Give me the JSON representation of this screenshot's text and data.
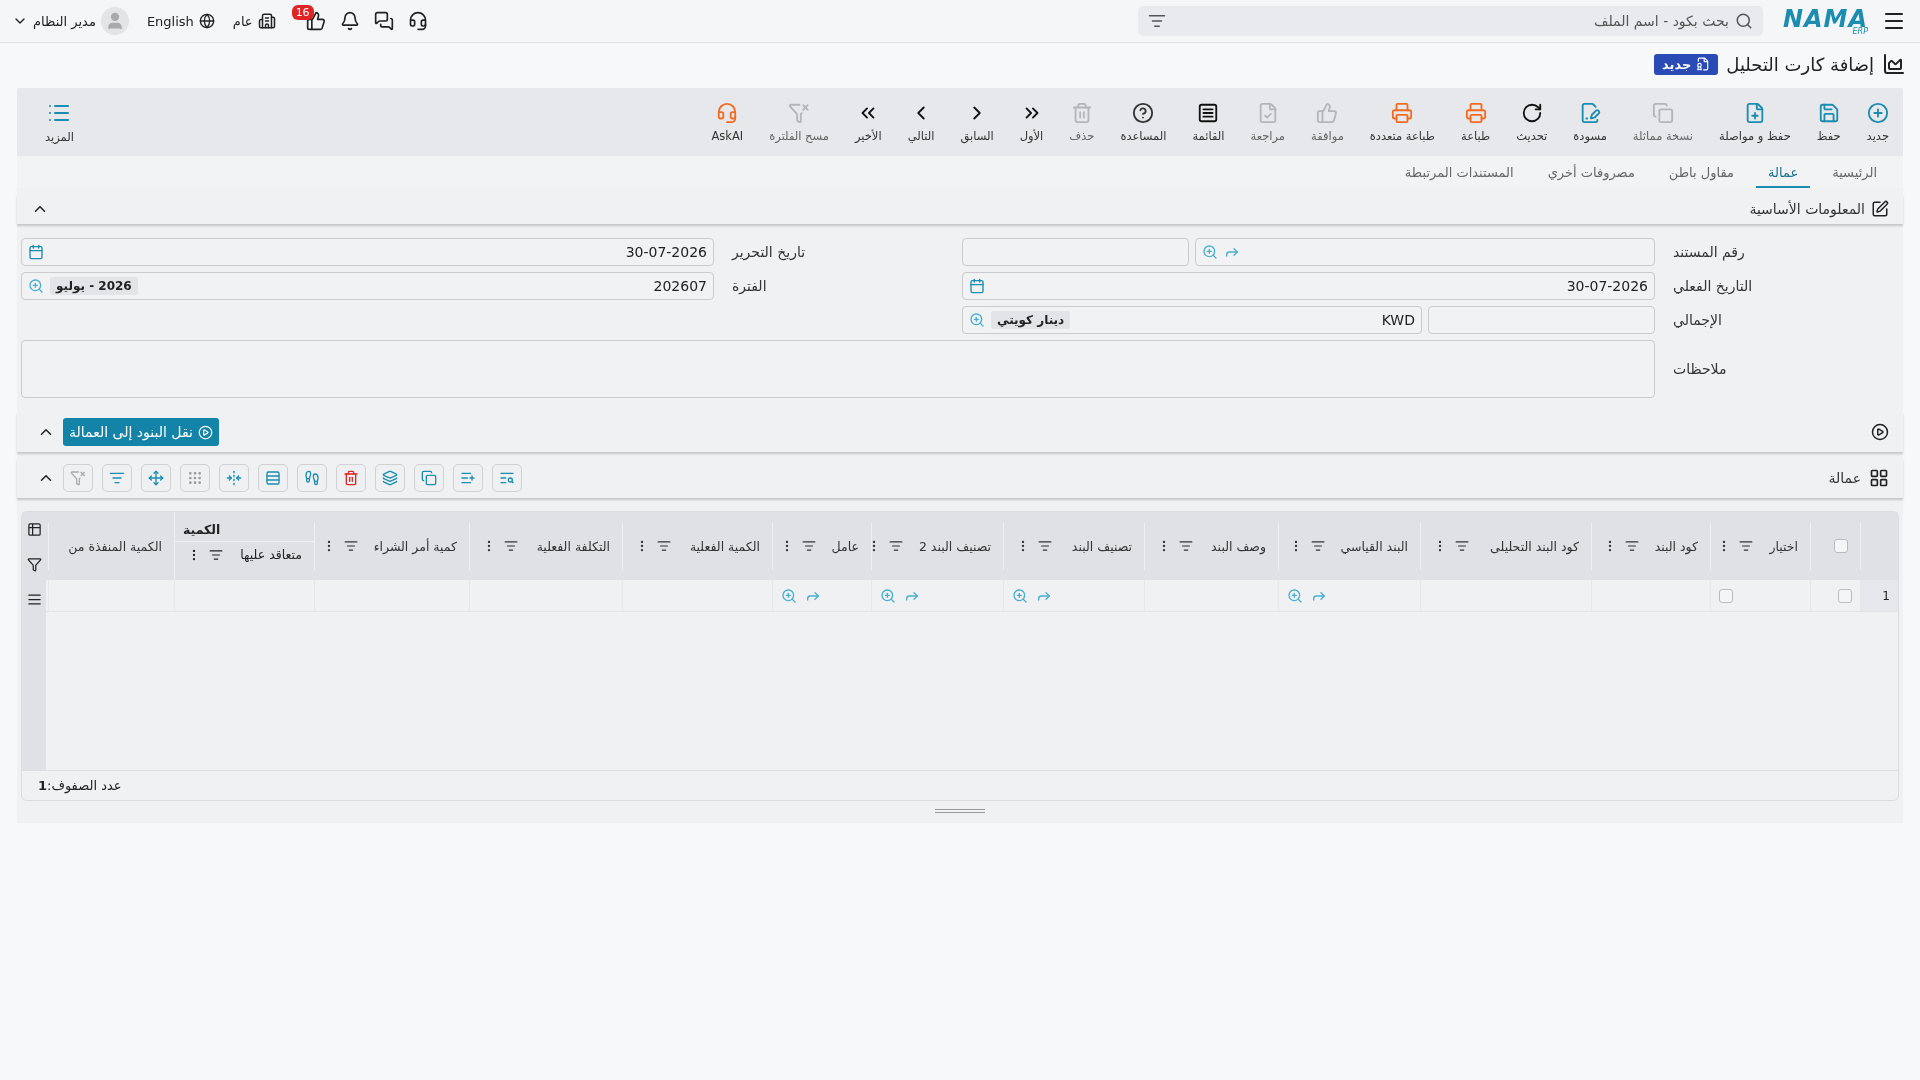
{
  "top_bar": {
    "logo": "NAMA",
    "logo_sub": "ERP",
    "search": {
      "placeholder": "بحث بكود - اسم الملف"
    },
    "user": "مدير النظام",
    "language": "English",
    "branch": "عام",
    "notification_count": "16"
  },
  "page": {
    "title": "إضافة كارت التحليل",
    "badge": "جديد"
  },
  "toolbar": [
    {
      "label": "جديد",
      "disabled": false
    },
    {
      "label": "حفظ",
      "disabled": false
    },
    {
      "label": "حفظ و مواصلة",
      "disabled": false
    },
    {
      "label": "نسخة مماثلة",
      "disabled": true
    },
    {
      "label": "مسودة",
      "disabled": false
    },
    {
      "label": "تحديث",
      "disabled": false
    },
    {
      "label": "طباعة",
      "disabled": false
    },
    {
      "label": "طباعة متعددة",
      "disabled": false
    },
    {
      "label": "موافقة",
      "disabled": true
    },
    {
      "label": "مراجعة",
      "disabled": true
    },
    {
      "label": "القائمة",
      "disabled": false
    },
    {
      "label": "المساعدة",
      "disabled": false
    },
    {
      "label": "حذف",
      "disabled": true
    },
    {
      "label": "الأول",
      "disabled": false
    },
    {
      "label": "السابق",
      "disabled": false
    },
    {
      "label": "التالي",
      "disabled": false
    },
    {
      "label": "الأخير",
      "disabled": false
    },
    {
      "label": "مسح الفلترة",
      "disabled": true
    },
    {
      "label": "AskAI",
      "disabled": false
    }
  ],
  "more": "المزيد",
  "tabs": [
    {
      "label": "الرئيسية",
      "selected": false
    },
    {
      "label": "عمالة",
      "selected": true
    },
    {
      "label": "مقاول باطن",
      "selected": false
    },
    {
      "label": "مصروفات أخري",
      "selected": false
    },
    {
      "label": "المستندات المرتبطة",
      "selected": false
    }
  ],
  "basic_info": {
    "title": "المعلومات الأساسية",
    "document_number": {
      "label": "رقم المستند"
    },
    "actual_date": {
      "label": "التاريخ الفعلي",
      "value": "30-07-2026"
    },
    "total": {
      "label": "الإجمالي",
      "currency": "KWD",
      "currency_name": "دينار كويتي"
    },
    "notes": {
      "label": "ملاحظات"
    },
    "edit_date": {
      "label": "تاريخ التحرير",
      "value": "30-07-2026"
    },
    "period": {
      "label": "الفترة",
      "value": "202607",
      "period_name": "2026 - يوليو"
    }
  },
  "action": {
    "label": "نقل البنود إلى العمالة"
  },
  "grid": {
    "title": "عمالة",
    "select_all": {
      "checked": false
    },
    "columns": [
      {
        "label": "اختيار",
        "kind": "check",
        "filter": true
      },
      {
        "label": "كود البند",
        "kind": "text",
        "filter": true
      },
      {
        "label": "كود البند التحليلى",
        "kind": "text",
        "filter": true
      },
      {
        "label": "البند القياسي",
        "kind": "lookup",
        "filter": true
      },
      {
        "label": "وصف البند",
        "kind": "text",
        "filter": true
      },
      {
        "label": "تصنيف البند",
        "kind": "lookup",
        "filter": true
      },
      {
        "label": "تصنيف البند 2",
        "kind": "lookup",
        "filter": true
      },
      {
        "label": "عامل",
        "kind": "lookup",
        "filter": true
      },
      {
        "label": "الكمية الفعلية",
        "kind": "text",
        "filter": true
      },
      {
        "label": "التكلفة الفعلية",
        "kind": "text",
        "filter": true
      },
      {
        "label": "كمية أمر الشراء",
        "kind": "text",
        "filter": true
      },
      {
        "label": "متعاقد عليها",
        "group": "الكمية",
        "kind": "text",
        "filter": true
      },
      {
        "label": "الكمية المنفذة من",
        "kind": "text",
        "filter": false
      }
    ],
    "rows": [
      {
        "number": "1",
        "selected": false,
        "choice": false
      }
    ],
    "row_count": "عدد الصفوف:**1**"
  }
}
